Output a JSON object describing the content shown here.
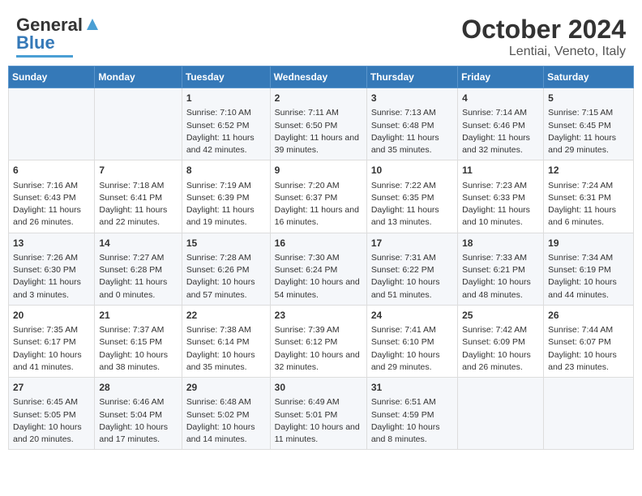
{
  "header": {
    "logo_general": "General",
    "logo_blue": "Blue",
    "month": "October 2024",
    "location": "Lentiai, Veneto, Italy"
  },
  "days_of_week": [
    "Sunday",
    "Monday",
    "Tuesday",
    "Wednesday",
    "Thursday",
    "Friday",
    "Saturday"
  ],
  "weeks": [
    [
      {
        "day": null,
        "info": null
      },
      {
        "day": null,
        "info": null
      },
      {
        "day": "1",
        "sunrise": "Sunrise: 7:10 AM",
        "sunset": "Sunset: 6:52 PM",
        "daylight": "Daylight: 11 hours and 42 minutes."
      },
      {
        "day": "2",
        "sunrise": "Sunrise: 7:11 AM",
        "sunset": "Sunset: 6:50 PM",
        "daylight": "Daylight: 11 hours and 39 minutes."
      },
      {
        "day": "3",
        "sunrise": "Sunrise: 7:13 AM",
        "sunset": "Sunset: 6:48 PM",
        "daylight": "Daylight: 11 hours and 35 minutes."
      },
      {
        "day": "4",
        "sunrise": "Sunrise: 7:14 AM",
        "sunset": "Sunset: 6:46 PM",
        "daylight": "Daylight: 11 hours and 32 minutes."
      },
      {
        "day": "5",
        "sunrise": "Sunrise: 7:15 AM",
        "sunset": "Sunset: 6:45 PM",
        "daylight": "Daylight: 11 hours and 29 minutes."
      }
    ],
    [
      {
        "day": "6",
        "sunrise": "Sunrise: 7:16 AM",
        "sunset": "Sunset: 6:43 PM",
        "daylight": "Daylight: 11 hours and 26 minutes."
      },
      {
        "day": "7",
        "sunrise": "Sunrise: 7:18 AM",
        "sunset": "Sunset: 6:41 PM",
        "daylight": "Daylight: 11 hours and 22 minutes."
      },
      {
        "day": "8",
        "sunrise": "Sunrise: 7:19 AM",
        "sunset": "Sunset: 6:39 PM",
        "daylight": "Daylight: 11 hours and 19 minutes."
      },
      {
        "day": "9",
        "sunrise": "Sunrise: 7:20 AM",
        "sunset": "Sunset: 6:37 PM",
        "daylight": "Daylight: 11 hours and 16 minutes."
      },
      {
        "day": "10",
        "sunrise": "Sunrise: 7:22 AM",
        "sunset": "Sunset: 6:35 PM",
        "daylight": "Daylight: 11 hours and 13 minutes."
      },
      {
        "day": "11",
        "sunrise": "Sunrise: 7:23 AM",
        "sunset": "Sunset: 6:33 PM",
        "daylight": "Daylight: 11 hours and 10 minutes."
      },
      {
        "day": "12",
        "sunrise": "Sunrise: 7:24 AM",
        "sunset": "Sunset: 6:31 PM",
        "daylight": "Daylight: 11 hours and 6 minutes."
      }
    ],
    [
      {
        "day": "13",
        "sunrise": "Sunrise: 7:26 AM",
        "sunset": "Sunset: 6:30 PM",
        "daylight": "Daylight: 11 hours and 3 minutes."
      },
      {
        "day": "14",
        "sunrise": "Sunrise: 7:27 AM",
        "sunset": "Sunset: 6:28 PM",
        "daylight": "Daylight: 11 hours and 0 minutes."
      },
      {
        "day": "15",
        "sunrise": "Sunrise: 7:28 AM",
        "sunset": "Sunset: 6:26 PM",
        "daylight": "Daylight: 10 hours and 57 minutes."
      },
      {
        "day": "16",
        "sunrise": "Sunrise: 7:30 AM",
        "sunset": "Sunset: 6:24 PM",
        "daylight": "Daylight: 10 hours and 54 minutes."
      },
      {
        "day": "17",
        "sunrise": "Sunrise: 7:31 AM",
        "sunset": "Sunset: 6:22 PM",
        "daylight": "Daylight: 10 hours and 51 minutes."
      },
      {
        "day": "18",
        "sunrise": "Sunrise: 7:33 AM",
        "sunset": "Sunset: 6:21 PM",
        "daylight": "Daylight: 10 hours and 48 minutes."
      },
      {
        "day": "19",
        "sunrise": "Sunrise: 7:34 AM",
        "sunset": "Sunset: 6:19 PM",
        "daylight": "Daylight: 10 hours and 44 minutes."
      }
    ],
    [
      {
        "day": "20",
        "sunrise": "Sunrise: 7:35 AM",
        "sunset": "Sunset: 6:17 PM",
        "daylight": "Daylight: 10 hours and 41 minutes."
      },
      {
        "day": "21",
        "sunrise": "Sunrise: 7:37 AM",
        "sunset": "Sunset: 6:15 PM",
        "daylight": "Daylight: 10 hours and 38 minutes."
      },
      {
        "day": "22",
        "sunrise": "Sunrise: 7:38 AM",
        "sunset": "Sunset: 6:14 PM",
        "daylight": "Daylight: 10 hours and 35 minutes."
      },
      {
        "day": "23",
        "sunrise": "Sunrise: 7:39 AM",
        "sunset": "Sunset: 6:12 PM",
        "daylight": "Daylight: 10 hours and 32 minutes."
      },
      {
        "day": "24",
        "sunrise": "Sunrise: 7:41 AM",
        "sunset": "Sunset: 6:10 PM",
        "daylight": "Daylight: 10 hours and 29 minutes."
      },
      {
        "day": "25",
        "sunrise": "Sunrise: 7:42 AM",
        "sunset": "Sunset: 6:09 PM",
        "daylight": "Daylight: 10 hours and 26 minutes."
      },
      {
        "day": "26",
        "sunrise": "Sunrise: 7:44 AM",
        "sunset": "Sunset: 6:07 PM",
        "daylight": "Daylight: 10 hours and 23 minutes."
      }
    ],
    [
      {
        "day": "27",
        "sunrise": "Sunrise: 6:45 AM",
        "sunset": "Sunset: 5:05 PM",
        "daylight": "Daylight: 10 hours and 20 minutes."
      },
      {
        "day": "28",
        "sunrise": "Sunrise: 6:46 AM",
        "sunset": "Sunset: 5:04 PM",
        "daylight": "Daylight: 10 hours and 17 minutes."
      },
      {
        "day": "29",
        "sunrise": "Sunrise: 6:48 AM",
        "sunset": "Sunset: 5:02 PM",
        "daylight": "Daylight: 10 hours and 14 minutes."
      },
      {
        "day": "30",
        "sunrise": "Sunrise: 6:49 AM",
        "sunset": "Sunset: 5:01 PM",
        "daylight": "Daylight: 10 hours and 11 minutes."
      },
      {
        "day": "31",
        "sunrise": "Sunrise: 6:51 AM",
        "sunset": "Sunset: 4:59 PM",
        "daylight": "Daylight: 10 hours and 8 minutes."
      },
      {
        "day": null,
        "info": null
      },
      {
        "day": null,
        "info": null
      }
    ]
  ]
}
